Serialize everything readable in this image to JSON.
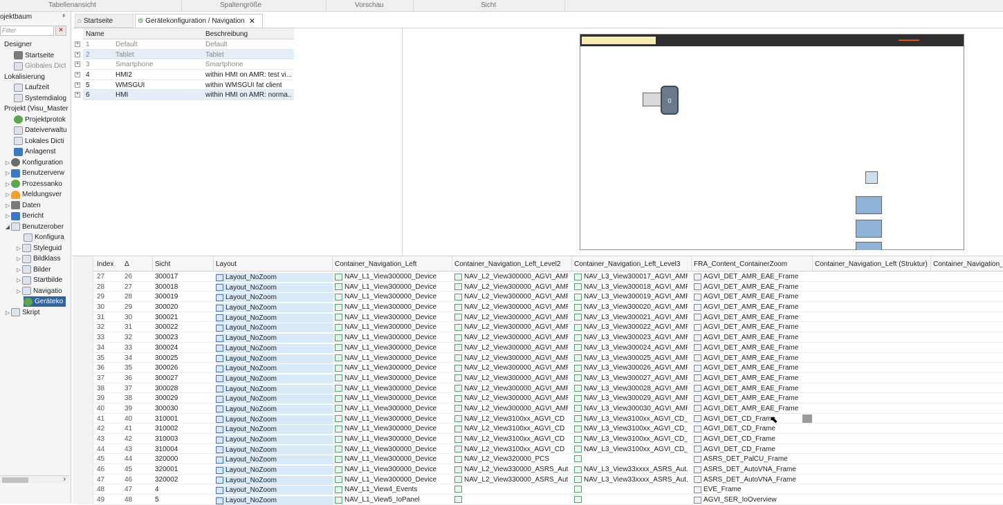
{
  "topbar": {
    "items": [
      "Tabellenansicht",
      "Spaltengröße",
      "Vorschau",
      "Sicht"
    ]
  },
  "sidebar": {
    "title": "ojektbaum",
    "pin": "📌",
    "filter_placeholder": "Filter",
    "items": [
      {
        "label": "Designer",
        "indent": 6,
        "exp": "",
        "icon": ""
      },
      {
        "label": "Startseite",
        "indent": 20,
        "exp": "",
        "icon": "gray",
        "dis": false
      },
      {
        "label": "Globales Dict",
        "indent": 20,
        "exp": "",
        "icon": "doc",
        "dis": true
      },
      {
        "label": "Lokalisierung",
        "indent": 6,
        "exp": "",
        "icon": ""
      },
      {
        "label": "Laufzeit",
        "indent": 20,
        "exp": "",
        "icon": "doc"
      },
      {
        "label": "Systemdialog",
        "indent": 20,
        "exp": "",
        "icon": "doc"
      },
      {
        "label": "Projekt (Visu_Master",
        "indent": 6,
        "exp": "",
        "icon": ""
      },
      {
        "label": "Projektprotok",
        "indent": 20,
        "exp": "",
        "icon": "green"
      },
      {
        "label": "Dateiverwaltu",
        "indent": 20,
        "exp": "",
        "icon": "doc"
      },
      {
        "label": "Lokales Dicti",
        "indent": 20,
        "exp": "",
        "icon": "doc"
      },
      {
        "label": "Anlagenst",
        "indent": 20,
        "exp": "",
        "icon": "blue"
      },
      {
        "label": "Konfiguration",
        "indent": 6,
        "exp": "▷",
        "icon": "gear"
      },
      {
        "label": "Benutzerverw",
        "indent": 6,
        "exp": "▷",
        "icon": "blue"
      },
      {
        "label": "Prozessanko",
        "indent": 6,
        "exp": "▷",
        "icon": "green"
      },
      {
        "label": "Meldungsver",
        "indent": 6,
        "exp": "▷",
        "icon": "orange"
      },
      {
        "label": "Daten",
        "indent": 6,
        "exp": "▷",
        "icon": "gray"
      },
      {
        "label": "Bericht",
        "indent": 6,
        "exp": "▷",
        "icon": "blue"
      },
      {
        "label": "Benutzerober",
        "indent": 6,
        "exp": "◢",
        "icon": "doc"
      },
      {
        "label": "Konfigura",
        "indent": 34,
        "exp": "",
        "icon": "doc"
      },
      {
        "label": "Styleguid",
        "indent": 22,
        "exp": "▷",
        "icon": "doc"
      },
      {
        "label": "Bildklass",
        "indent": 22,
        "exp": "▷",
        "icon": "doc"
      },
      {
        "label": "Bilder",
        "indent": 22,
        "exp": "▷",
        "icon": "doc"
      },
      {
        "label": "Startbilde",
        "indent": 22,
        "exp": "▷",
        "icon": "doc"
      },
      {
        "label": "Navigatio",
        "indent": 22,
        "exp": "▷",
        "icon": "doc"
      },
      {
        "label": "Geräteko",
        "indent": 34,
        "exp": "",
        "icon": "green",
        "sel": true
      },
      {
        "label": "Skript",
        "indent": 6,
        "exp": "▷",
        "icon": "doc"
      }
    ],
    "scroll_arrow": "›"
  },
  "tabs": [
    {
      "label": "Startseite"
    },
    {
      "label": "Gerätekonfiguration / Navigation",
      "close": "✕"
    }
  ],
  "devices": {
    "headers": [
      "Name",
      "Beschreibung"
    ],
    "rows": [
      {
        "id": "1",
        "name": "Default",
        "desc": "Default",
        "dis": true
      },
      {
        "id": "2",
        "name": "Tablet",
        "desc": "Tablet",
        "dis": true
      },
      {
        "id": "3",
        "name": "Smartphone",
        "desc": "Smartphone",
        "dis": true
      },
      {
        "id": "4",
        "name": "HMI2",
        "desc": "within HMI on AMR: test vi..."
      },
      {
        "id": "5",
        "name": "WMSGUI",
        "desc": "within WMSGUI fat client"
      },
      {
        "id": "6",
        "name": "HMI",
        "desc": "within HMI on AMR: norma..."
      }
    ]
  },
  "preview": {
    "badge": "0"
  },
  "grid": {
    "headers": [
      "Index",
      "Δ",
      "Sicht",
      "Layout",
      "Container_Navigation_Left",
      "Container_Navigation_Left_Level2",
      "Container_Navigation_Left_Level3",
      "FRA_Content_ContainerZoom",
      "Container_Navigation_Left (Struktur)",
      "Container_Navigation_"
    ],
    "rows": [
      [
        "27",
        "26",
        "300017",
        "Layout_NoZoom",
        "NAV_L1_View300000_Device",
        "NAV_L2_View300000_AGVI_AMR",
        "NAV_L3_View300017_AGVI_AMR",
        "AGVI_DET_AMR_EAE_Frame"
      ],
      [
        "28",
        "27",
        "300018",
        "Layout_NoZoom",
        "NAV_L1_View300000_Device",
        "NAV_L2_View300000_AGVI_AMR",
        "NAV_L3_View300018_AGVI_AMR",
        "AGVI_DET_AMR_EAE_Frame"
      ],
      [
        "29",
        "28",
        "300019",
        "Layout_NoZoom",
        "NAV_L1_View300000_Device",
        "NAV_L2_View300000_AGVI_AMR",
        "NAV_L3_View300019_AGVI_AMR",
        "AGVI_DET_AMR_EAE_Frame"
      ],
      [
        "30",
        "29",
        "300020",
        "Layout_NoZoom",
        "NAV_L1_View300000_Device",
        "NAV_L2_View300000_AGVI_AMR",
        "NAV_L3_View300020_AGVI_AMR",
        "AGVI_DET_AMR_EAE_Frame"
      ],
      [
        "31",
        "30",
        "300021",
        "Layout_NoZoom",
        "NAV_L1_View300000_Device",
        "NAV_L2_View300000_AGVI_AMR",
        "NAV_L3_View300021_AGVI_AMR",
        "AGVI_DET_AMR_EAE_Frame"
      ],
      [
        "32",
        "31",
        "300022",
        "Layout_NoZoom",
        "NAV_L1_View300000_Device",
        "NAV_L2_View300000_AGVI_AMR",
        "NAV_L3_View300022_AGVI_AMR",
        "AGVI_DET_AMR_EAE_Frame"
      ],
      [
        "33",
        "32",
        "300023",
        "Layout_NoZoom",
        "NAV_L1_View300000_Device",
        "NAV_L2_View300000_AGVI_AMR",
        "NAV_L3_View300023_AGVI_AMR",
        "AGVI_DET_AMR_EAE_Frame"
      ],
      [
        "34",
        "33",
        "300024",
        "Layout_NoZoom",
        "NAV_L1_View300000_Device",
        "NAV_L2_View300000_AGVI_AMR",
        "NAV_L3_View300024_AGVI_AMR",
        "AGVI_DET_AMR_EAE_Frame"
      ],
      [
        "35",
        "34",
        "300025",
        "Layout_NoZoom",
        "NAV_L1_View300000_Device",
        "NAV_L2_View300000_AGVI_AMR",
        "NAV_L3_View300025_AGVI_AMR",
        "AGVI_DET_AMR_EAE_Frame"
      ],
      [
        "36",
        "35",
        "300026",
        "Layout_NoZoom",
        "NAV_L1_View300000_Device",
        "NAV_L2_View300000_AGVI_AMR",
        "NAV_L3_View300026_AGVI_AMR",
        "AGVI_DET_AMR_EAE_Frame"
      ],
      [
        "37",
        "36",
        "300027",
        "Layout_NoZoom",
        "NAV_L1_View300000_Device",
        "NAV_L2_View300000_AGVI_AMR",
        "NAV_L3_View300027_AGVI_AMR",
        "AGVI_DET_AMR_EAE_Frame"
      ],
      [
        "38",
        "37",
        "300028",
        "Layout_NoZoom",
        "NAV_L1_View300000_Device",
        "NAV_L2_View300000_AGVI_AMR",
        "NAV_L3_View300028_AGVI_AMR",
        "AGVI_DET_AMR_EAE_Frame"
      ],
      [
        "39",
        "38",
        "300029",
        "Layout_NoZoom",
        "NAV_L1_View300000_Device",
        "NAV_L2_View300000_AGVI_AMR",
        "NAV_L3_View300029_AGVI_AMR",
        "AGVI_DET_AMR_EAE_Frame"
      ],
      [
        "40",
        "39",
        "300030",
        "Layout_NoZoom",
        "NAV_L1_View300000_Device",
        "NAV_L2_View300000_AGVI_AMR",
        "NAV_L3_View300030_AGVI_AMR",
        "AGVI_DET_AMR_EAE_Frame"
      ],
      [
        "41",
        "40",
        "310001",
        "Layout_NoZoom",
        "NAV_L1_View300000_Device",
        "NAV_L2_View3100xx_AGVI_CD",
        "NAV_L3_View3100xx_AGVI_CD_...",
        "AGVI_DET_CD_Frame"
      ],
      [
        "42",
        "41",
        "310002",
        "Layout_NoZoom",
        "NAV_L1_View300000_Device",
        "NAV_L2_View3100xx_AGVI_CD",
        "NAV_L3_View3100xx_AGVI_CD_...",
        "AGVI_DET_CD_Frame"
      ],
      [
        "43",
        "42",
        "310003",
        "Layout_NoZoom",
        "NAV_L1_View300000_Device",
        "NAV_L2_View3100xx_AGVI_CD",
        "NAV_L3_View3100xx_AGVI_CD_...",
        "AGVI_DET_CD_Frame"
      ],
      [
        "44",
        "43",
        "310004",
        "Layout_NoZoom",
        "NAV_L1_View300000_Device",
        "NAV_L2_View3100xx_AGVI_CD",
        "NAV_L3_View3100xx_AGVI_CD_...",
        "AGVI_DET_CD_Frame"
      ],
      [
        "45",
        "44",
        "320000",
        "Layout_NoZoom",
        "NAV_L1_View300000_Device",
        "NAV_L2_View320000_PCS",
        "",
        "ASRS_DET_PalCU_Frame"
      ],
      [
        "46",
        "45",
        "320001",
        "Layout_NoZoom",
        "NAV_L1_View300000_Device",
        "NAV_L2_View330000_ASRS_Aut...",
        "NAV_L3_View33xxxx_ASRS_Aut...",
        "ASRS_DET_AutoVNA_Frame"
      ],
      [
        "47",
        "46",
        "320002",
        "Layout_NoZoom",
        "NAV_L1_View300000_Device",
        "NAV_L2_View330000_ASRS_Aut...",
        "NAV_L3_View33xxxx_ASRS_Aut...",
        "ASRS_DET_AutoVNA_Frame"
      ],
      [
        "48",
        "47",
        "4",
        "Layout_NoZoom",
        "NAV_L1_View4_Events",
        "",
        "",
        "EVE_Frame"
      ],
      [
        "49",
        "48",
        "5",
        "Layout_NoZoom",
        "NAV_L1_View5_IoPanel",
        "",
        "",
        "AGVI_SER_IoOverview"
      ]
    ]
  }
}
